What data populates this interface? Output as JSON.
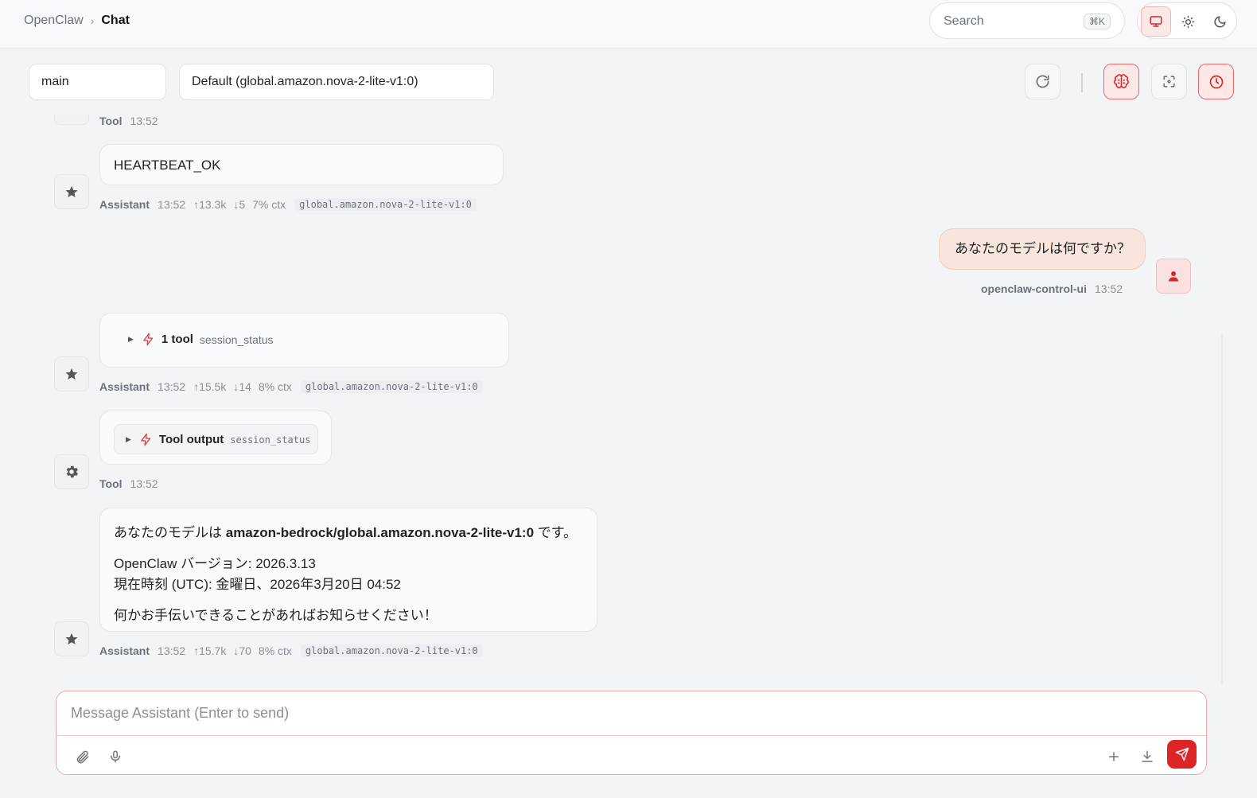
{
  "header": {
    "breadcrumb_root": "OpenClaw",
    "breadcrumb_sep": "›",
    "breadcrumb_current": "Chat",
    "search_placeholder": "Search",
    "search_shortcut": "⌘K",
    "theme_options": [
      "system",
      "light",
      "dark"
    ],
    "theme_active": "system"
  },
  "session": {
    "session_key": "main",
    "model_select": "Default (global.amazon.nova-2-lite-v1:0)"
  },
  "colors": {
    "accent": "#dc2626",
    "user_bubble": "#f8e5dc",
    "background": "#f3f4f6"
  },
  "messages": [
    {
      "role": "Tool",
      "time": "13:52"
    },
    {
      "role": "Assistant",
      "text": "HEARTBEAT_OK",
      "time": "13:52",
      "tokens_in": "↑13.3k",
      "tokens_out": "↓5",
      "ctx": "7% ctx",
      "model": "global.amazon.nova-2-lite-v1:0"
    },
    {
      "role": "openclaw-control-ui",
      "text": "あなたのモデルは何ですか？",
      "time": "13:52"
    },
    {
      "role": "Assistant",
      "tool_count": "1 tool",
      "tool_name": "session_status",
      "time": "13:52",
      "tokens_in": "↑15.5k",
      "tokens_out": "↓14",
      "ctx": "8% ctx",
      "model": "global.amazon.nova-2-lite-v1:0"
    },
    {
      "role": "Tool",
      "tool_output_label": "Tool output",
      "tool_name": "session_status",
      "time": "13:52"
    },
    {
      "role": "Assistant",
      "line1_prefix": "あなたのモデルは ",
      "line1_bold": "amazon-bedrock/global.amazon.nova-2-lite-v1:0",
      "line1_suffix": " です。",
      "line2": "OpenClaw バージョン: 2026.3.13",
      "line3": "現在時刻 (UTC): 金曜日、2026年3月20日 04:52",
      "line4": "何かお手伝いできることがあればお知らせください！",
      "time": "13:52",
      "tokens_in": "↑15.7k",
      "tokens_out": "↓70",
      "ctx": "8% ctx",
      "model": "global.amazon.nova-2-lite-v1:0"
    }
  ],
  "composer": {
    "placeholder": "Message Assistant (Enter to send)"
  }
}
